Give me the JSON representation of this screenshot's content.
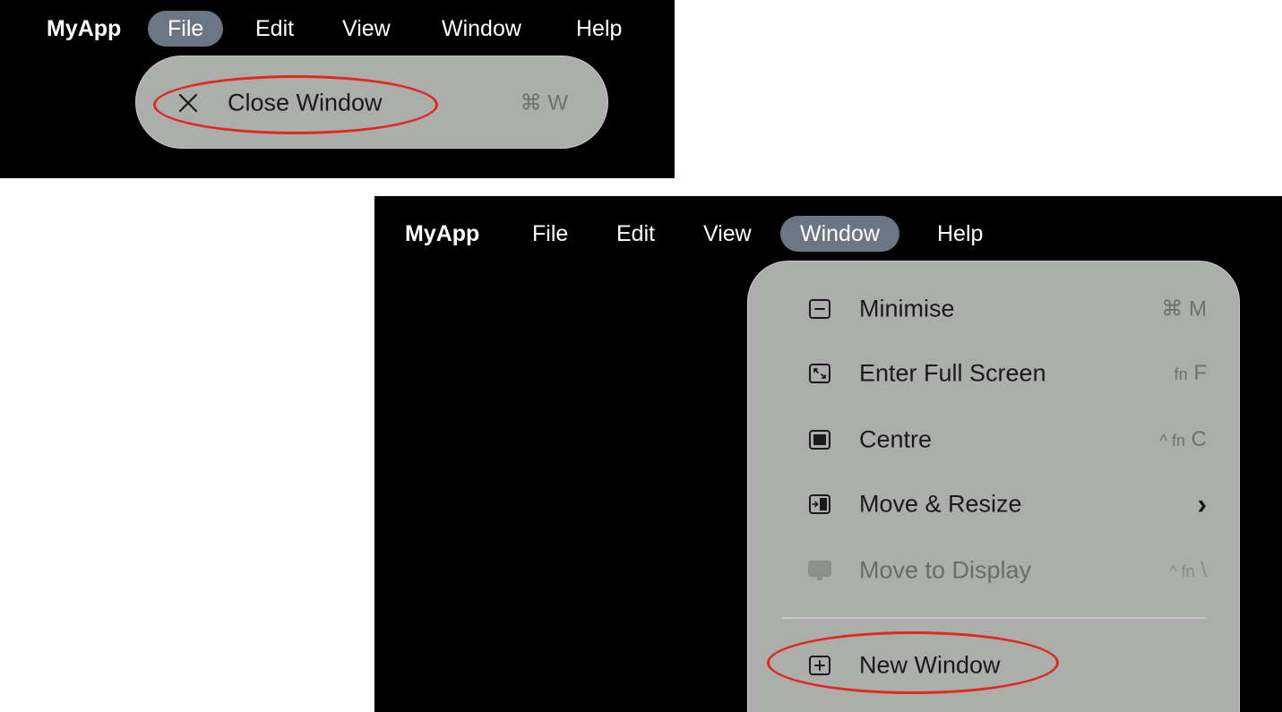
{
  "menubar": {
    "app_name": "MyApp",
    "items": [
      "File",
      "Edit",
      "View",
      "Window",
      "Help"
    ]
  },
  "top_panel": {
    "active_menu": "File",
    "file_menu": {
      "close_window": {
        "label": "Close Window",
        "shortcut": "⌘ W"
      }
    }
  },
  "bottom_panel": {
    "active_menu": "Window",
    "window_menu": {
      "minimise": {
        "label": "Minimise",
        "shortcut": "⌘ M"
      },
      "enter_full_screen": {
        "label": "Enter Full Screen",
        "shortcut_mod": "fn",
        "shortcut_key": "F"
      },
      "centre": {
        "label": "Centre",
        "shortcut_mod": "^ fn",
        "shortcut_key": "C"
      },
      "move_resize": {
        "label": "Move & Resize",
        "submenu_indicator": "›"
      },
      "move_to_display": {
        "label": "Move to Display",
        "shortcut_mod": "^ fn",
        "shortcut_key": "\\",
        "disabled": true
      },
      "new_window": {
        "label": "New Window"
      }
    }
  },
  "colors": {
    "active_menu_bg": "#6a7684",
    "menu_bg": "#acaeac",
    "highlight_oval": "#e0281d"
  }
}
